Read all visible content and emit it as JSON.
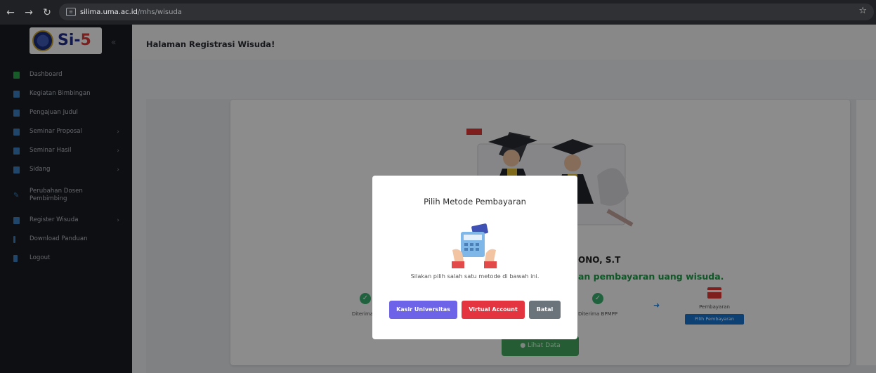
{
  "browser": {
    "url_host": "silima.uma.ac.id",
    "url_path": "/mhs/wisuda"
  },
  "sidebar": {
    "logo_text": "Si-",
    "logo_num": "5",
    "items": [
      {
        "label": "Dashboard",
        "color": "#3b82c4"
      },
      {
        "label": "Kegiatan Bimbingan",
        "color": "#3b82c4"
      },
      {
        "label": "Pengajuan Judul",
        "color": "#3b82c4"
      },
      {
        "label": "Seminar Proposal",
        "color": "#3b82c4",
        "chevron": true
      },
      {
        "label": "Seminar Hasil",
        "color": "#3b82c4",
        "chevron": true
      },
      {
        "label": "Sidang",
        "color": "#3b82c4",
        "chevron": true
      },
      {
        "label": "Perubahan Dosen Pembimbing",
        "color": "#3b82c4"
      },
      {
        "label": "Register Wisuda",
        "color": "#3b82c4",
        "chevron": true
      },
      {
        "label": "Download Panduan",
        "color": "#3b82c4"
      },
      {
        "label": "Logout",
        "color": "#3b82c4"
      }
    ]
  },
  "page": {
    "title": "Halaman Registrasi Wisuda!",
    "name_partial": "ONO, S.T",
    "status_partial": "an pembayaran uang wisuda.",
    "step1_label": "Diterima",
    "step2_label": "Diterima BPMPP",
    "step3_label": "Pembayaran",
    "pilih_btn": "Pilih Pembayaran",
    "lihat_btn": "Lihat Data"
  },
  "modal": {
    "title": "Pilih Metode Pembayaran",
    "text": "Silakan pilih salah satu metode di bawah ini.",
    "btn_kasir": "Kasir Universitas",
    "btn_va": "Virtual Account",
    "btn_batal": "Batal"
  }
}
